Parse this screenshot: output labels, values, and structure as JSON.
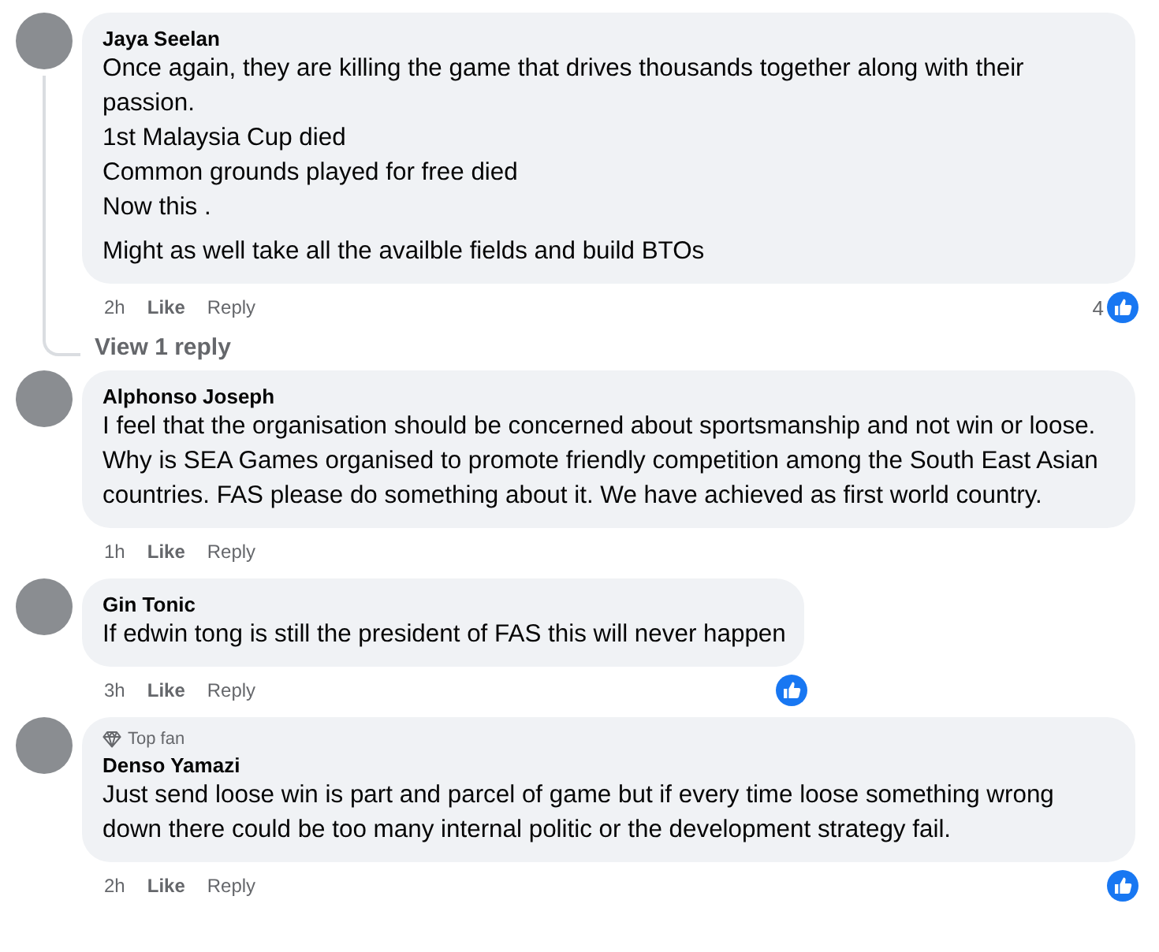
{
  "comments": [
    {
      "author": "Jaya Seelan",
      "paragraphs": [
        "Once again, they are killing the game that drives thousands together along with their passion.\n1st Malaysia Cup died\nCommon grounds played for free died\nNow this .",
        "Might as well take all the availble fields and build BTOs"
      ],
      "time": "2h",
      "like": "Like",
      "reply": "Reply",
      "reaction": true,
      "reaction_count": "4",
      "view_replies": "View 1 reply"
    },
    {
      "author": "Alphonso Joseph",
      "paragraphs": [
        "I feel that the organisation should be concerned about sportsmanship and not win or loose. Why is SEA Games organised to promote friendly competition among the South East Asian countries. FAS please do something about it. We have achieved as first world country."
      ],
      "time": "1h",
      "like": "Like",
      "reply": "Reply",
      "reaction": false
    },
    {
      "author": "Gin Tonic",
      "paragraphs": [
        "If edwin tong is still the president of FAS this will never happen"
      ],
      "time": "3h",
      "like": "Like",
      "reply": "Reply",
      "reaction": true
    },
    {
      "author": "Denso Yamazi",
      "top_fan_badge": "Top fan",
      "paragraphs": [
        "Just send loose win is part and parcel of game but if every time loose something wrong down there could be too many internal politic or the development strategy fail."
      ],
      "time": "2h",
      "like": "Like",
      "reply": "Reply",
      "reaction": true
    }
  ]
}
